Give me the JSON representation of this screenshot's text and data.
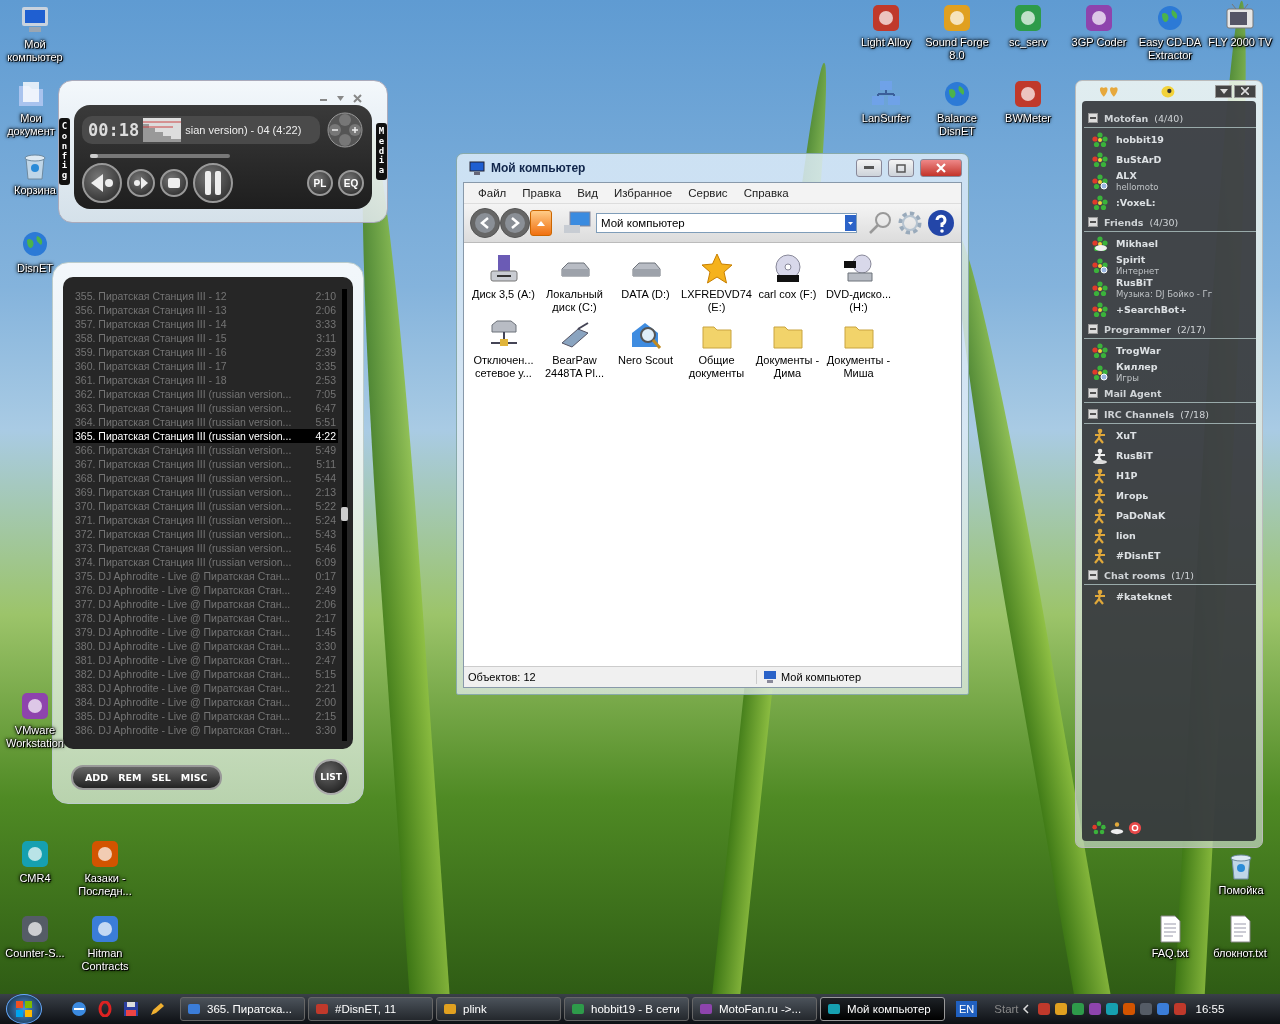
{
  "desktop_icons": [
    {
      "label": "Мой компьютер",
      "kind": "computer"
    },
    {
      "label": "Мои документ",
      "kind": "documents"
    },
    {
      "label": "Корзина",
      "kind": "trash"
    },
    {
      "label": "DisnET",
      "kind": "globe"
    },
    {
      "label": "VMware Workstation",
      "kind": "app"
    },
    {
      "label": "CMR4",
      "kind": "app"
    },
    {
      "label": "Казаки - Последн...",
      "kind": "app"
    },
    {
      "label": "Counter-S...",
      "kind": "app"
    },
    {
      "label": "Hitman Contracts",
      "kind": "app"
    },
    {
      "label": "Light Alloy",
      "kind": "app"
    },
    {
      "label": "Sound Forge 8.0",
      "kind": "app"
    },
    {
      "label": "sc_serv",
      "kind": "app"
    },
    {
      "label": "3GP Coder",
      "kind": "app"
    },
    {
      "label": "Easy CD-DA Extractor",
      "kind": "globe"
    },
    {
      "label": "FLY 2000 TV",
      "kind": "tv"
    },
    {
      "label": "LanSurfer",
      "kind": "network"
    },
    {
      "label": "Balance DisnET",
      "kind": "globe"
    },
    {
      "label": "BWMeter",
      "kind": "app"
    },
    {
      "label": "Помойка",
      "kind": "trash"
    },
    {
      "label": "FAQ.txt",
      "kind": "text-file"
    },
    {
      "label": "блокнот.txt",
      "kind": "text-file"
    }
  ],
  "player": {
    "time": "00:18",
    "title": "sian version) - 04 (4:22)",
    "level": 0.06,
    "left_tab": "Config",
    "right_tab": "Media",
    "buttons": [
      "PL",
      "EQ"
    ]
  },
  "playlist": {
    "items": [
      {
        "title": "355. Пиратская Станция III - 12",
        "duration": "2:10",
        "selected": false
      },
      {
        "title": "356. Пиратская Станция III - 13",
        "duration": "2:06",
        "selected": false
      },
      {
        "title": "357. Пиратская Станция III - 14",
        "duration": "3:33",
        "selected": false
      },
      {
        "title": "358. Пиратская Станция III - 15",
        "duration": "3:11",
        "selected": false
      },
      {
        "title": "359. Пиратская Станция III - 16",
        "duration": "2:39",
        "selected": false
      },
      {
        "title": "360. Пиратская Станция III - 17",
        "duration": "3:35",
        "selected": false
      },
      {
        "title": "361. Пиратская Станция III - 18",
        "duration": "2:53",
        "selected": false
      },
      {
        "title": "362. Пиратская Станция III (russian version...",
        "duration": "7:05",
        "selected": false
      },
      {
        "title": "363. Пиратская Станция III (russian version...",
        "duration": "6:47",
        "selected": false
      },
      {
        "title": "364. Пиратская Станция III (russian version...",
        "duration": "5:51",
        "selected": false
      },
      {
        "title": "365. Пиратская Станция III (russian version...",
        "duration": "4:22",
        "selected": true
      },
      {
        "title": "366. Пиратская Станция III (russian version...",
        "duration": "5:49",
        "selected": false
      },
      {
        "title": "367. Пиратская Станция III (russian version...",
        "duration": "5:11",
        "selected": false
      },
      {
        "title": "368. Пиратская Станция III (russian version...",
        "duration": "5:44",
        "selected": false
      },
      {
        "title": "369. Пиратская Станция III (russian version...",
        "duration": "2:13",
        "selected": false
      },
      {
        "title": "370. Пиратская Станция III (russian version...",
        "duration": "5:22",
        "selected": false
      },
      {
        "title": "371. Пиратская Станция III (russian version...",
        "duration": "5:24",
        "selected": false
      },
      {
        "title": "372. Пиратская Станция III (russian version...",
        "duration": "5:43",
        "selected": false
      },
      {
        "title": "373. Пиратская Станция III (russian version...",
        "duration": "5:46",
        "selected": false
      },
      {
        "title": "374. Пиратская Станция III (russian version...",
        "duration": "6:09",
        "selected": false
      },
      {
        "title": "375. DJ Aphrodite - Live @ Пиратская Стан...",
        "duration": "0:17",
        "selected": false
      },
      {
        "title": "376. DJ Aphrodite - Live @ Пиратская Стан...",
        "duration": "2:49",
        "selected": false
      },
      {
        "title": "377. DJ Aphrodite - Live @ Пиратская Стан...",
        "duration": "2:06",
        "selected": false
      },
      {
        "title": "378. DJ Aphrodite - Live @ Пиратская Стан...",
        "duration": "2:17",
        "selected": false
      },
      {
        "title": "379. DJ Aphrodite - Live @ Пиратская Стан...",
        "duration": "1:45",
        "selected": false
      },
      {
        "title": "380. DJ Aphrodite - Live @ Пиратская Стан...",
        "duration": "3:30",
        "selected": false
      },
      {
        "title": "381. DJ Aphrodite - Live @ Пиратская Стан...",
        "duration": "2:47",
        "selected": false
      },
      {
        "title": "382. DJ Aphrodite - Live @ Пиратская Стан...",
        "duration": "5:15",
        "selected": false
      },
      {
        "title": "383. DJ Aphrodite - Live @ Пиратская Стан...",
        "duration": "2:21",
        "selected": false
      },
      {
        "title": "384. DJ Aphrodite - Live @ Пиратская Стан...",
        "duration": "2:00",
        "selected": false
      },
      {
        "title": "385. DJ Aphrodite - Live @ Пиратская Стан...",
        "duration": "2:15",
        "selected": false
      },
      {
        "title": "386. DJ Aphrodite - Live @ Пиратская Стан...",
        "duration": "3:30",
        "selected": false
      }
    ],
    "buttons": [
      "ADD",
      "REM",
      "SEL",
      "MISC"
    ],
    "list_button": "LIST"
  },
  "explorer": {
    "title": "Мой компьютер",
    "menu": [
      "Файл",
      "Правка",
      "Вид",
      "Избранное",
      "Сервис",
      "Справка"
    ],
    "address": "Мой компьютер",
    "items": [
      {
        "label": "Диск 3,5 (A:)",
        "kind": "floppy"
      },
      {
        "label": "Локальный диск (C:)",
        "kind": "drive"
      },
      {
        "label": "DATA (D:)",
        "kind": "drive"
      },
      {
        "label": "LXFREDVD74 (E:)",
        "kind": "star"
      },
      {
        "label": "carl cox (F:)",
        "kind": "cdrom"
      },
      {
        "label": "DVD-диско... (H:)",
        "kind": "dvd"
      },
      {
        "label": "Отключен... сетевое у...",
        "kind": "network-drive"
      },
      {
        "label": "BearPaw 2448TA Pl...",
        "kind": "scanner"
      },
      {
        "label": "Nero Scout",
        "kind": "nero"
      },
      {
        "label": "Общие документы",
        "kind": "folder"
      },
      {
        "label": "Документы - Дима",
        "kind": "folder"
      },
      {
        "label": "Документы - Миша",
        "kind": "folder"
      }
    ],
    "status_left": "Объектов: 12",
    "status_right": "Мой компьютер"
  },
  "contacts": {
    "groups": [
      {
        "name": "Motofan",
        "count": "(4/40)",
        "expanded": true,
        "contacts": [
          {
            "name": "hobbit19",
            "kind": "icq"
          },
          {
            "name": "BuStArD",
            "kind": "icq"
          },
          {
            "name": "ALX",
            "status": "hellomoto",
            "kind": "icq-away"
          },
          {
            "name": ":VoxeL:",
            "kind": "icq"
          }
        ]
      },
      {
        "name": "Friends",
        "count": "(4/30)",
        "expanded": true,
        "contacts": [
          {
            "name": "Mikhael",
            "kind": "icq-cloud"
          },
          {
            "name": "Spirit",
            "status": "Интернет",
            "kind": "icq-away"
          },
          {
            "name": "RusBiT",
            "status": "Музыка: DJ Бойко - Гг",
            "kind": "icq"
          },
          {
            "name": "+SearchBot+",
            "kind": "icq"
          }
        ]
      },
      {
        "name": "Programmer",
        "count": "(2/17)",
        "expanded": true,
        "contacts": [
          {
            "name": "TrogWar",
            "kind": "icq"
          },
          {
            "name": "Киллер",
            "status": "Игры",
            "kind": "icq-away"
          }
        ]
      },
      {
        "name": "Mail Agent",
        "expanded": true
      },
      {
        "name": "IRC Channels",
        "count": "(7/18)",
        "expanded": true,
        "contacts": [
          {
            "name": "XuT",
            "kind": "irc"
          },
          {
            "name": "RusBiT",
            "kind": "irc-away"
          },
          {
            "name": "H1P",
            "kind": "irc"
          },
          {
            "name": "Игорь",
            "kind": "irc"
          },
          {
            "name": "PaDoNaK",
            "kind": "irc"
          },
          {
            "name": "lion",
            "kind": "irc"
          },
          {
            "name": "#DisnET",
            "kind": "irc"
          }
        ]
      },
      {
        "name": "Chat rooms",
        "count": "(1/1)",
        "expanded": true,
        "contacts": [
          {
            "name": "#kateknet",
            "kind": "irc"
          }
        ]
      }
    ]
  },
  "taskbar": {
    "tasks": [
      {
        "label": "365. Пиратска...",
        "selected": false
      },
      {
        "label": "#DisnET, 11",
        "selected": false
      },
      {
        "label": "plink",
        "selected": false
      },
      {
        "label": "hobbit19 - В сети",
        "selected": false
      },
      {
        "label": "MotoFan.ru ->...",
        "selected": false
      },
      {
        "label": "Мой компьютер",
        "selected": true
      }
    ],
    "language": "EN",
    "toolbar_label": "Start",
    "clock": "16:55"
  }
}
